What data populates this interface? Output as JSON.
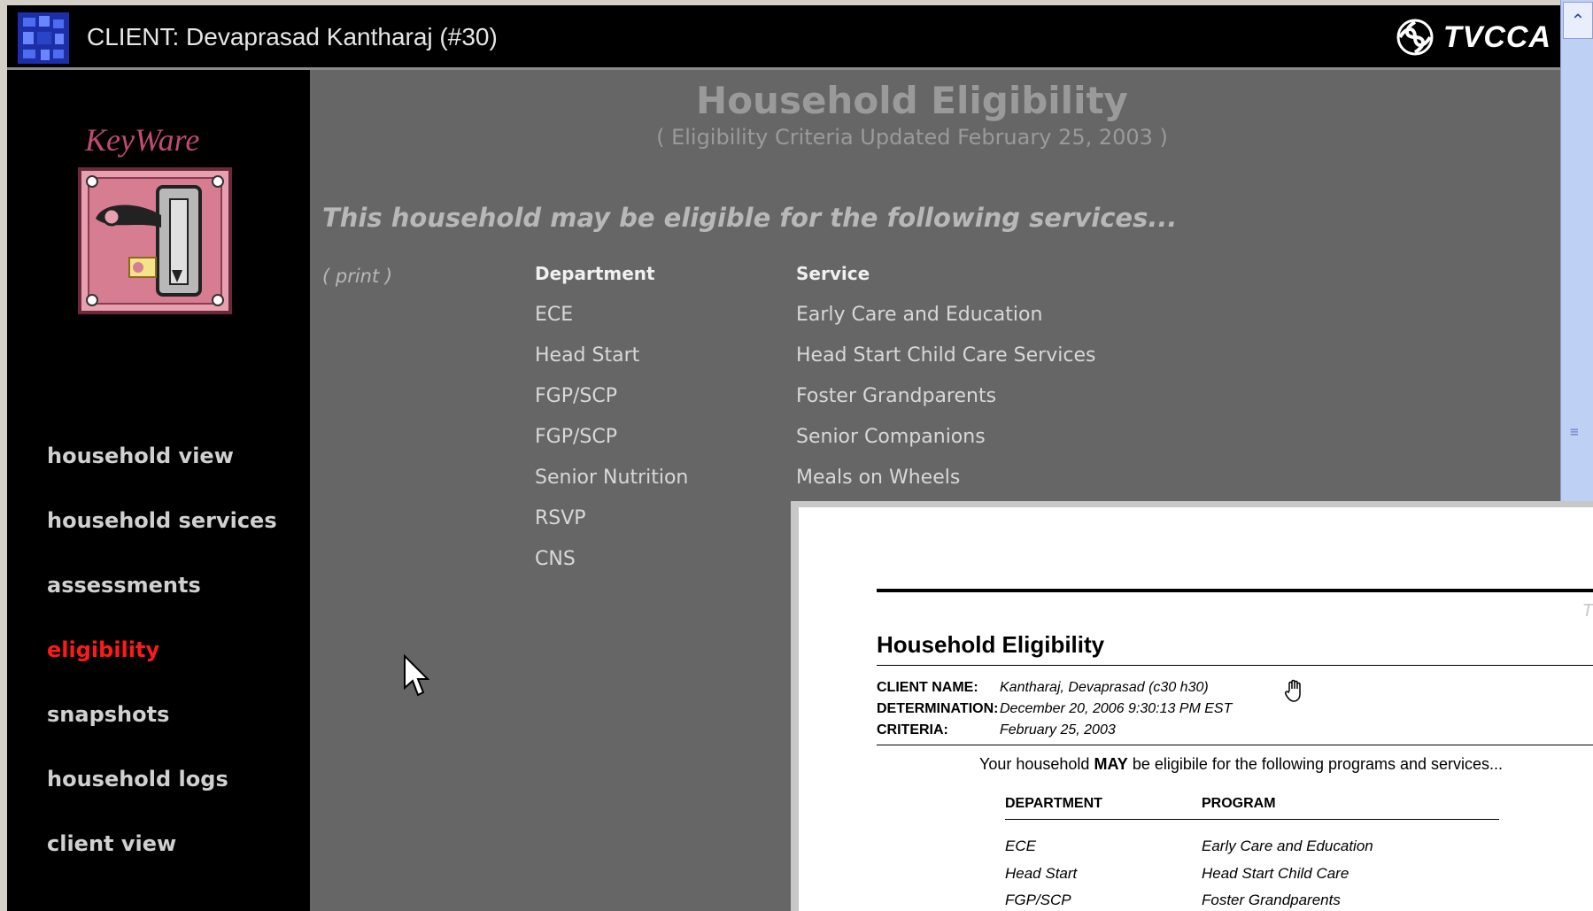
{
  "header": {
    "client_label": "CLIENT: Devaprasad Kantharaj (#30)",
    "brand": "TVCCA"
  },
  "sidebar": {
    "logo_text": "KeyWare",
    "items": [
      {
        "label": "household view"
      },
      {
        "label": "household services"
      },
      {
        "label": "assessments"
      },
      {
        "label": "eligibility"
      },
      {
        "label": "snapshots"
      },
      {
        "label": "household logs"
      },
      {
        "label": "client view"
      }
    ],
    "active_item": "eligibility"
  },
  "main": {
    "title": "Household Eligibility",
    "subtitle": "( Eligibility Criteria Updated February 25, 2003 )",
    "lead": "This household may be eligible for the following services...",
    "print_link": "( print )",
    "columns": {
      "department": "Department",
      "service": "Service"
    },
    "rows": [
      {
        "department": "ECE",
        "service": "Early Care and Education"
      },
      {
        "department": "Head Start",
        "service": "Head Start Child Care Services"
      },
      {
        "department": "FGP/SCP",
        "service": "Foster Grandparents"
      },
      {
        "department": "FGP/SCP",
        "service": "Senior Companions"
      },
      {
        "department": "Senior Nutrition",
        "service": "Meals on Wheels"
      },
      {
        "department": "RSVP",
        "service": ""
      },
      {
        "department": "CNS",
        "service": ""
      }
    ]
  },
  "print_preview": {
    "corner_text": "T",
    "title": "Household Eligibility",
    "fields": [
      {
        "label": "CLIENT NAME:",
        "value": "Kantharaj, Devaprasad (c30 h30)"
      },
      {
        "label": "DETERMINATION:",
        "value": "December 20, 2006 9:30:13 PM EST"
      },
      {
        "label": "CRITERIA:",
        "value": "February 25, 2003"
      }
    ],
    "message_prefix": "Your household",
    "message_bold": "MAY",
    "message_suffix": "be eligibile for the following programs and services...",
    "columns": {
      "department": "DEPARTMENT",
      "program": "PROGRAM"
    },
    "rows": [
      {
        "department": "ECE",
        "program": "Early Care and Education"
      },
      {
        "department": "Head Start",
        "program": "Head Start Child Care"
      },
      {
        "department": "FGP/SCP",
        "program": "Foster Grandparents"
      }
    ]
  },
  "colors": {
    "topbar_bg": "#000000",
    "sidebar_bg": "#000000",
    "main_bg": "#666666",
    "active_nav": "#ff1a1a",
    "logo_pink": "#c04a74",
    "scrollbar": "#bfd0f5"
  },
  "icons": [
    "app-icon",
    "tvcca-swirl-icon",
    "keyware-lock-logo",
    "scroll-up-arrow-icon",
    "scroll-grip-icon",
    "mouse-pointer-icon",
    "hand-cursor-icon"
  ]
}
